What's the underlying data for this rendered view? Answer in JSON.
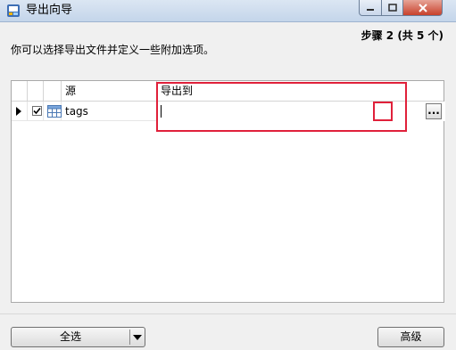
{
  "window": {
    "title": "导出向导",
    "title_icon": "export-wizard-icon",
    "controls": {
      "minimize_icon": "minimize-icon",
      "maximize_icon": "maximize-icon",
      "close_icon": "close-icon"
    }
  },
  "header": {
    "step": "步骤 2 (共 5 个)",
    "description": "你可以选择导出文件并定义一些附加选项。"
  },
  "grid": {
    "columns": [
      "源",
      "导出到"
    ],
    "rows": [
      {
        "selected_arrow_icon": "row-pointer-icon",
        "checked": true,
        "source_icon": "table-icon",
        "source": "tags",
        "export_to": "",
        "browse_label": "..."
      }
    ]
  },
  "footer": {
    "select_all_label": "全选",
    "dropdown_icon": "chevron-down-icon",
    "advanced_label": "高级"
  },
  "colors": {
    "highlight": "#e0203a",
    "titlebar": "#c4d5ea"
  }
}
